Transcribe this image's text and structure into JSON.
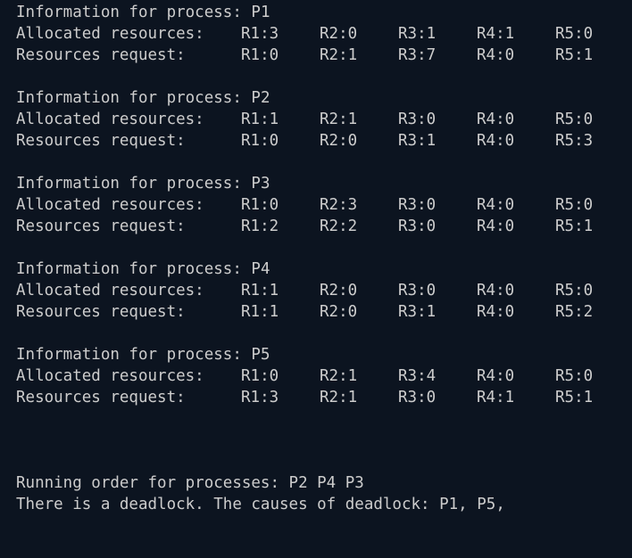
{
  "labels": {
    "info_prefix": "Information for process: ",
    "allocated": "Allocated resources:",
    "request": "Resources request:"
  },
  "processes": [
    {
      "name": "P1",
      "allocated": [
        "R1:3",
        "R2:0",
        "R3:1",
        "R4:1",
        "R5:0"
      ],
      "request": [
        "R1:0",
        "R2:1",
        "R3:7",
        "R4:0",
        "R5:1"
      ]
    },
    {
      "name": "P2",
      "allocated": [
        "R1:1",
        "R2:1",
        "R3:0",
        "R4:0",
        "R5:0"
      ],
      "request": [
        "R1:0",
        "R2:0",
        "R3:1",
        "R4:0",
        "R5:3"
      ]
    },
    {
      "name": "P3",
      "allocated": [
        "R1:0",
        "R2:3",
        "R3:0",
        "R4:0",
        "R5:0"
      ],
      "request": [
        "R1:2",
        "R2:2",
        "R3:0",
        "R4:0",
        "R5:1"
      ]
    },
    {
      "name": "P4",
      "allocated": [
        "R1:1",
        "R2:0",
        "R3:0",
        "R4:0",
        "R5:0"
      ],
      "request": [
        "R1:1",
        "R2:0",
        "R3:1",
        "R4:0",
        "R5:2"
      ]
    },
    {
      "name": "P5",
      "allocated": [
        "R1:0",
        "R2:1",
        "R3:4",
        "R4:0",
        "R5:0"
      ],
      "request": [
        "R1:3",
        "R2:1",
        "R3:0",
        "R4:1",
        "R5:1"
      ]
    }
  ],
  "summary": {
    "running_order": "Running order for processes: P2 P4 P3",
    "deadlock": "There is a deadlock. The causes of deadlock: P1, P5,"
  },
  "colors": {
    "background": "#0c1420",
    "text": "#cccccc"
  }
}
